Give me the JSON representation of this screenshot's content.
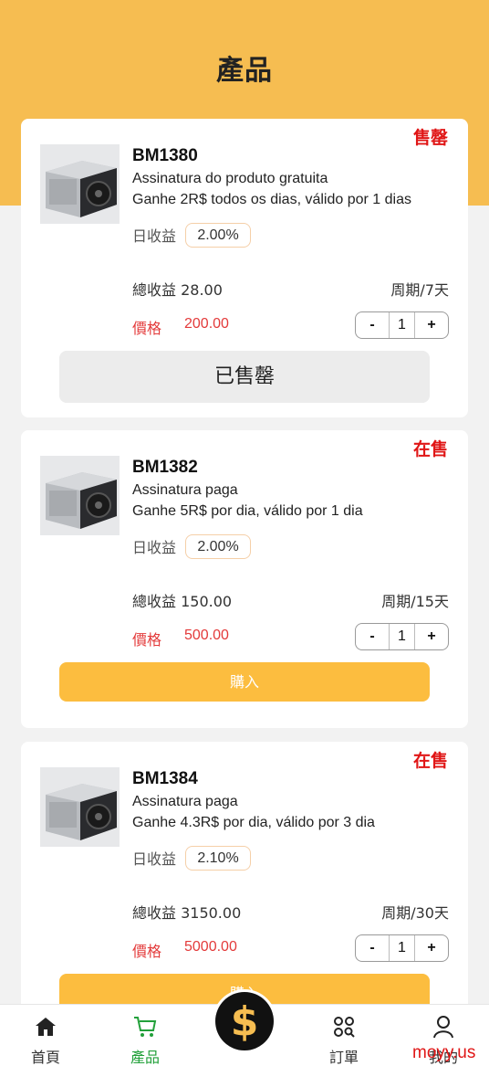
{
  "page": {
    "title": "產品"
  },
  "colors": {
    "accent": "#f6bd51",
    "button": "#fcbd3f",
    "price": "#e33a3a",
    "badge": "#e01616",
    "active_tab": "#22a03a"
  },
  "products": [
    {
      "badge": "售罄",
      "name": "BM1380",
      "desc1": "Assinatura do produto gratuita",
      "desc2": "Ganhe 2R$ todos os dias, válido por 1 dias",
      "daily_label": "日收益",
      "daily_value": "2.00%",
      "total_label": "總收益 28.00",
      "cycle_label": "周期/7天",
      "price_label": "價格",
      "price_value": "200.00",
      "qty_minus": "-",
      "qty": "1",
      "qty_plus": "+",
      "action_label": "已售罄",
      "action_type": "sold"
    },
    {
      "badge": "在售",
      "name": "BM1382",
      "desc1": "Assinatura paga",
      "desc2": "Ganhe 5R$ por dia, válido por 1 dia",
      "daily_label": "日收益",
      "daily_value": "2.00%",
      "total_label": "總收益 150.00",
      "cycle_label": "周期/15天",
      "price_label": "價格",
      "price_value": "500.00",
      "qty_minus": "-",
      "qty": "1",
      "qty_plus": "+",
      "action_label": "購入",
      "action_type": "buy"
    },
    {
      "badge": "在售",
      "name": "BM1384",
      "desc1": "Assinatura paga",
      "desc2": "Ganhe 4.3R$ por dia, válido por 3 dia",
      "daily_label": "日收益",
      "daily_value": "2.10%",
      "total_label": "總收益 3150.00",
      "cycle_label": "周期/30天",
      "price_label": "價格",
      "price_value": "5000.00",
      "qty_minus": "-",
      "qty": "1",
      "qty_plus": "+",
      "action_label": "購入",
      "action_type": "buy"
    }
  ],
  "tabbar": {
    "items": [
      {
        "label": "首頁",
        "icon": "home-icon",
        "active": false
      },
      {
        "label": "產品",
        "icon": "cart-icon",
        "active": true
      },
      {
        "label": "訂單",
        "icon": "orders-grid-icon",
        "active": false
      },
      {
        "label": "我的",
        "icon": "user-icon",
        "active": false
      }
    ],
    "center_symbol": "$"
  },
  "watermark": "moyy.us"
}
